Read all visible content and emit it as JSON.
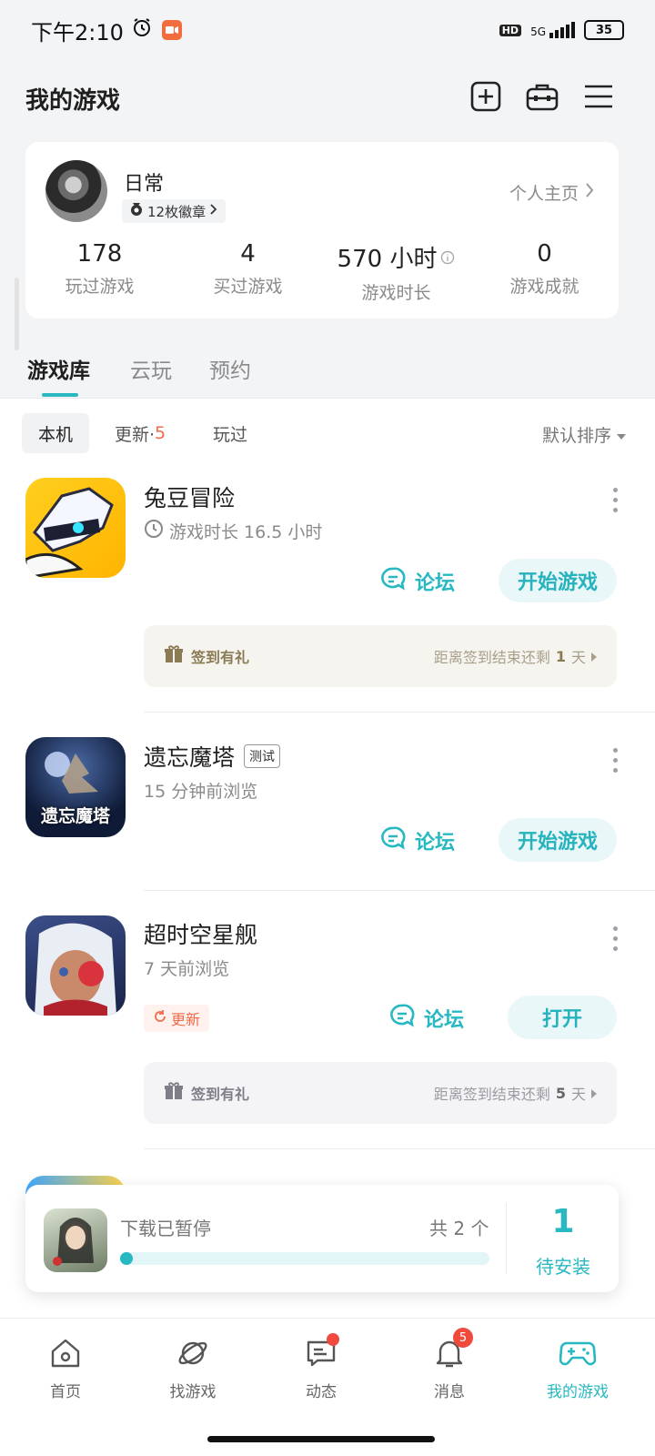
{
  "status_bar": {
    "time": "下午2:10",
    "network": "5G",
    "hd": "HD",
    "battery": "35"
  },
  "header": {
    "title": "我的游戏"
  },
  "profile": {
    "name": "日常",
    "badges": "12枚徽章",
    "profile_link": "个人主页",
    "stats": [
      {
        "value": "178",
        "label": "玩过游戏"
      },
      {
        "value": "4",
        "label": "买过游戏"
      },
      {
        "value": "570 小时",
        "label": "游戏时长"
      },
      {
        "value": "0",
        "label": "游戏成就"
      }
    ]
  },
  "tabs": [
    "游戏库",
    "云玩",
    "预约"
  ],
  "filters": {
    "local": "本机",
    "update": "更新·",
    "update_count": "5",
    "played": "玩过",
    "sort": "默认排序"
  },
  "games": [
    {
      "name": "兔豆冒险",
      "sub": "游戏时长 16.5 小时",
      "forum": "论坛",
      "action": "开始游戏",
      "signin": {
        "label": "签到有礼",
        "remain_prefix": "距离签到结束还剩",
        "days": "1",
        "unit": "天"
      }
    },
    {
      "name": "遗忘魔塔",
      "tag": "测试",
      "sub": "15 分钟前浏览",
      "forum": "论坛",
      "action": "开始游戏",
      "icon_text": "遗忘魔塔"
    },
    {
      "name": "超时空星舰",
      "sub": "7 天前浏览",
      "update_tag": "更新",
      "forum": "论坛",
      "action": "打开",
      "signin": {
        "label": "签到有礼",
        "remain_prefix": "距离签到结束还剩",
        "days": "5",
        "unit": "天"
      }
    }
  ],
  "download": {
    "status": "下载已暂停",
    "count": "共 2 个",
    "progress": 0.0,
    "pending_num": "1",
    "pending_label": "待安装"
  },
  "nav": {
    "items": [
      {
        "label": "首页",
        "icon": "home-icon"
      },
      {
        "label": "找游戏",
        "icon": "planet-icon"
      },
      {
        "label": "动态",
        "icon": "chat-icon"
      },
      {
        "label": "消息",
        "icon": "bell-icon",
        "badge": "5"
      },
      {
        "label": "我的游戏",
        "icon": "gamepad-icon"
      }
    ]
  },
  "colors": {
    "accent": "#27b8c1",
    "badge_red": "#ef4a3c",
    "update_orange": "#ef6b4a"
  }
}
